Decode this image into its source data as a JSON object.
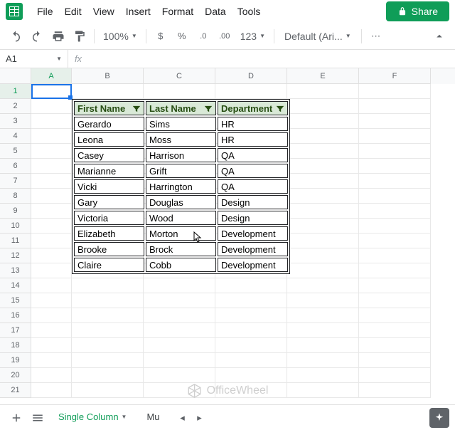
{
  "menus": [
    "File",
    "Edit",
    "View",
    "Insert",
    "Format",
    "Data",
    "Tools"
  ],
  "share_label": "Share",
  "zoom": "100%",
  "font": "Default (Ari...",
  "format_buttons": {
    "dollar": "$",
    "percent": "%",
    "dec_dec": ".0",
    "dec_inc": ".00",
    "num": "123"
  },
  "name_box": "A1",
  "columns": [
    "A",
    "B",
    "C",
    "D",
    "E",
    "F"
  ],
  "rows": [
    "1",
    "2",
    "3",
    "4",
    "5",
    "6",
    "7",
    "8",
    "9",
    "10",
    "11",
    "12",
    "13",
    "14",
    "15",
    "16",
    "17",
    "18",
    "19",
    "20",
    "21"
  ],
  "table": {
    "headers": [
      "First Name",
      "Last Name",
      "Department"
    ],
    "data": [
      [
        "Gerardo",
        "Sims",
        "HR"
      ],
      [
        "Leona",
        "Moss",
        "HR"
      ],
      [
        "Casey",
        "Harrison",
        "QA"
      ],
      [
        "Marianne",
        "Grift",
        "QA"
      ],
      [
        "Vicki",
        "Harrington",
        "QA"
      ],
      [
        "Gary",
        "Douglas",
        "Design"
      ],
      [
        "Victoria",
        "Wood",
        "Design"
      ],
      [
        "Elizabeth",
        "Morton",
        "Development"
      ],
      [
        "Brooke",
        "Brock",
        "Development"
      ],
      [
        "Claire",
        "Cobb",
        "Development"
      ]
    ]
  },
  "tabs": {
    "active": "Single Column",
    "next": "Mu"
  },
  "watermark": "OfficeWheel"
}
